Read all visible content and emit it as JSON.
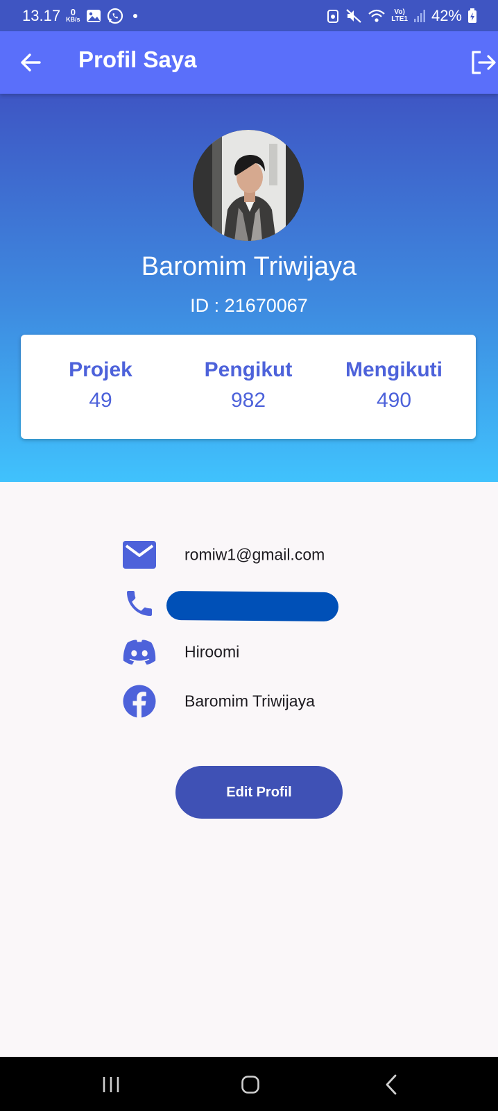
{
  "status_bar": {
    "time": "13.17",
    "net_speed_value": "0",
    "net_speed_unit": "KB/s",
    "lte_top": "Vo)",
    "lte_bottom": "LTE1",
    "battery": "42%"
  },
  "app_bar": {
    "title": "Profil Saya"
  },
  "profile": {
    "name": "Baromim Triwijaya",
    "id_text": "ID : 21670067"
  },
  "stats": [
    {
      "label": "Projek",
      "value": "49"
    },
    {
      "label": "Pengikut",
      "value": "982"
    },
    {
      "label": "Mengikuti",
      "value": "490"
    }
  ],
  "contacts": {
    "email": "romiw1@gmail.com",
    "phone": "",
    "discord": "Hiroomi",
    "facebook": "Baromim Triwijaya"
  },
  "actions": {
    "edit_label": "Edit Profil"
  },
  "colors": {
    "app_bar": "#5a6ffa",
    "status_bar": "#3f55c2",
    "accent": "#4d62da",
    "button": "#3f51b5",
    "gradient_top": "#3e56c4",
    "gradient_bottom": "#40c2fd"
  },
  "icons": {
    "back": "arrow-left-icon",
    "logout": "logout-icon",
    "email": "mail-icon",
    "phone": "phone-icon",
    "discord": "discord-icon",
    "facebook": "facebook-icon",
    "nav_recents": "recents-icon",
    "nav_home": "home-icon",
    "nav_back": "chevron-left-icon"
  }
}
